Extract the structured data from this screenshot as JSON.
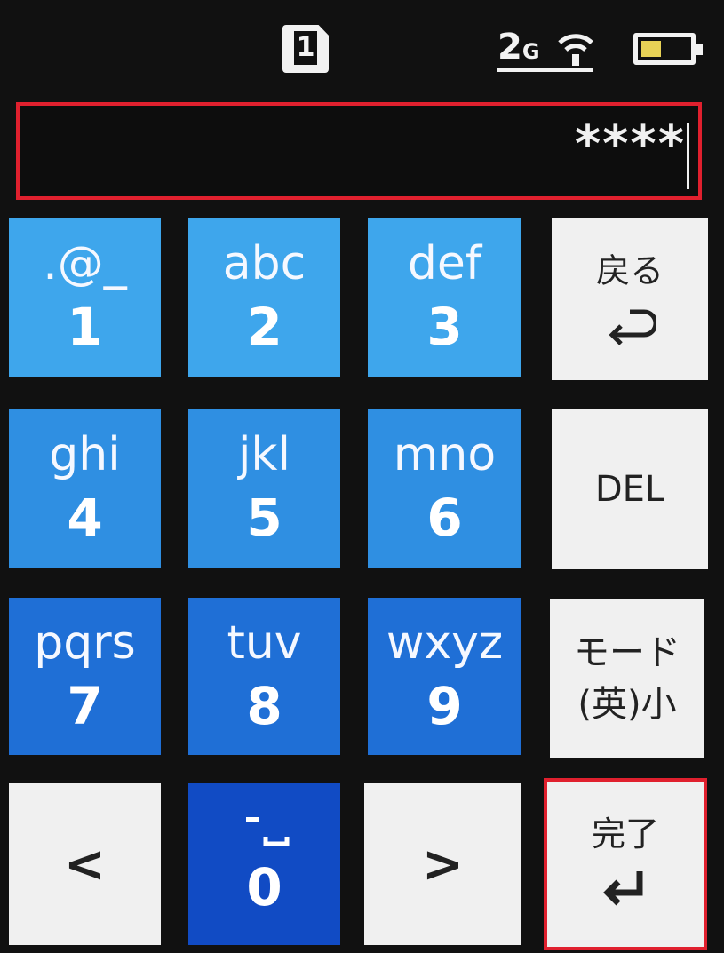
{
  "status_bar": {
    "sim_slot": "1",
    "network": "2",
    "network_suffix": "G",
    "icons": {
      "sim": "sim-card-icon",
      "wifi": "signal-icon",
      "battery": "battery-icon"
    }
  },
  "input": {
    "value": "****"
  },
  "keypad": {
    "key1": {
      "letters": ".@_",
      "digit": "1"
    },
    "key2": {
      "letters": "abc",
      "digit": "2"
    },
    "key3": {
      "letters": "def",
      "digit": "3"
    },
    "key4": {
      "letters": "ghi",
      "digit": "4"
    },
    "key5": {
      "letters": "jkl",
      "digit": "5"
    },
    "key6": {
      "letters": "mno",
      "digit": "6"
    },
    "key7": {
      "letters": "pqrs",
      "digit": "7"
    },
    "key8": {
      "letters": "tuv",
      "digit": "8"
    },
    "key9": {
      "letters": "wxyz",
      "digit": "9"
    },
    "key0": {
      "digit": "0"
    },
    "back": {
      "label": "戻る",
      "icon": "return-arrow-icon"
    },
    "del": {
      "label": "DEL"
    },
    "mode": {
      "line1": "モード",
      "line2": "(英)小"
    },
    "left": {
      "label": "<"
    },
    "right": {
      "label": ">"
    },
    "done": {
      "label": "完了",
      "icon": "enter-arrow-icon"
    }
  },
  "colors": {
    "highlight": "#e0202e",
    "key_light_blue": "#3ea6ec",
    "key_dark_blue": "#114bc4",
    "key_white": "#f0f0f0",
    "battery": "#e8d256"
  }
}
